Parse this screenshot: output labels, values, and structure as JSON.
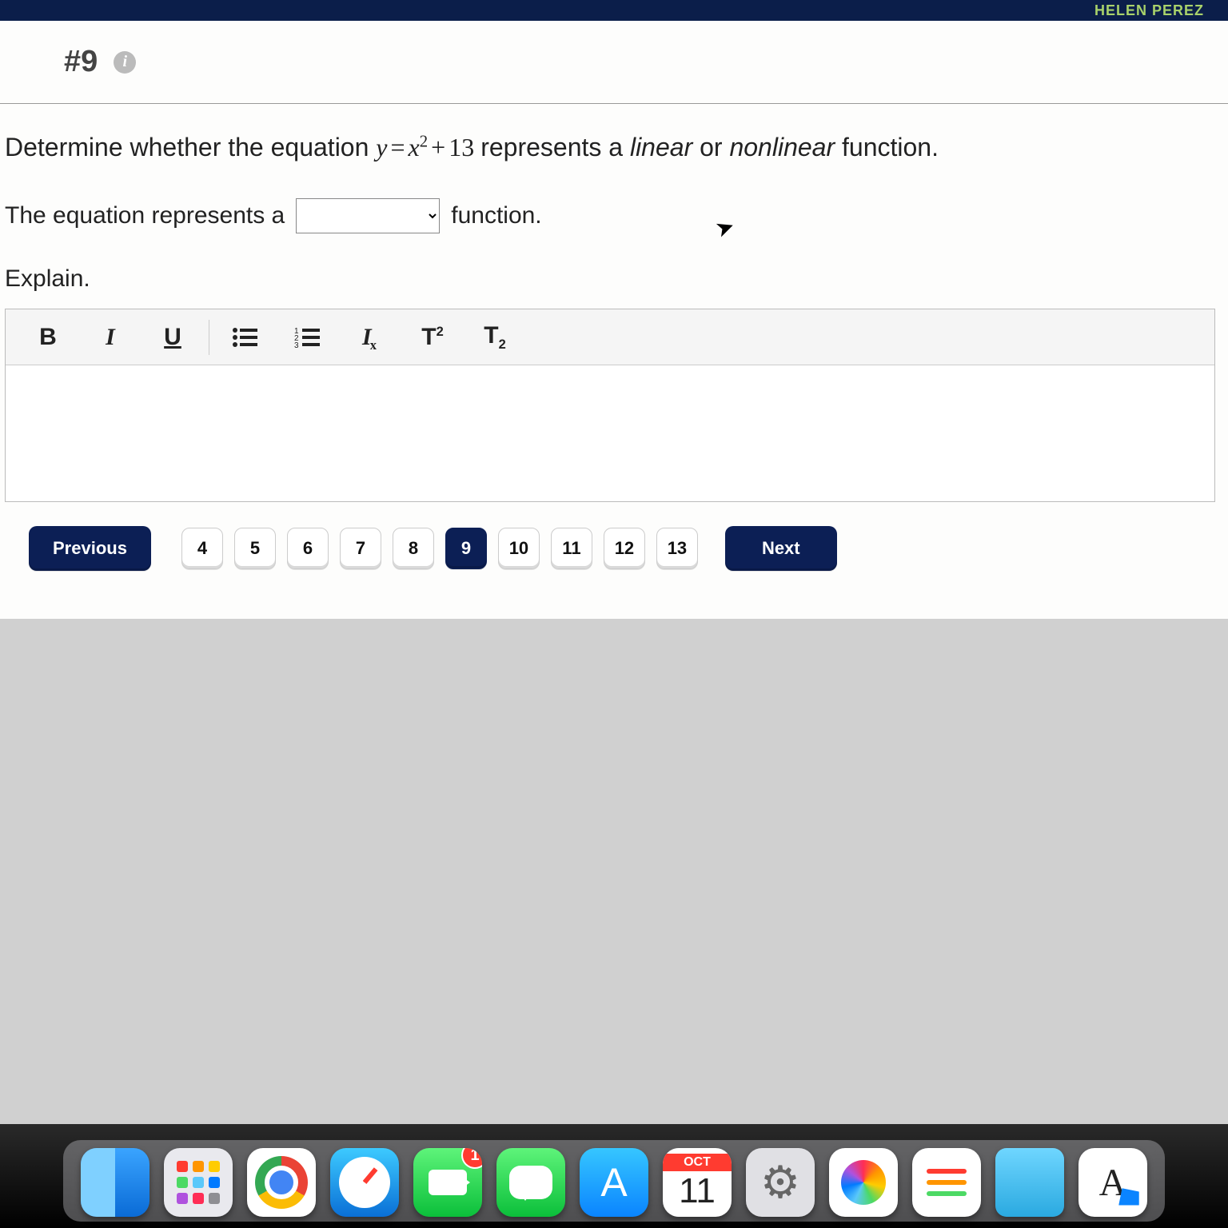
{
  "topbar": {
    "user_name": "HELEN PEREZ"
  },
  "question": {
    "number_label": "#9",
    "prompt_pre": "Determine whether the equation ",
    "equation_lhs": "y",
    "equation_eq": "=",
    "equation_rhs_var": "x",
    "equation_rhs_exp": "2",
    "equation_plus": "+",
    "equation_const": "13",
    "prompt_mid": " represents a ",
    "word_linear": "linear",
    "prompt_or": " or ",
    "word_nonlinear": "nonlinear",
    "prompt_post": " function.",
    "answer_pre": "The equation represents a ",
    "answer_post": " function.",
    "dropdown_value": "",
    "explain_label": "Explain."
  },
  "toolbar": {
    "bold": "B",
    "italic": "I",
    "underline": "U",
    "ul_icon": "≣",
    "ol_icon": "≡",
    "clearfmt_base": "I",
    "clearfmt_x": "x",
    "sup_base": "T",
    "sup_exp": "2",
    "sub_base": "T",
    "sub_exp": "2"
  },
  "nav": {
    "previous": "Previous",
    "next": "Next",
    "pages": [
      "4",
      "5",
      "6",
      "7",
      "8",
      "9",
      "10",
      "11",
      "12",
      "13"
    ],
    "active": "9"
  },
  "dock": {
    "facetime_badge": "1",
    "calendar_month": "OCT",
    "calendar_day": "11",
    "appstore_letter": "A",
    "font_letter": "A"
  }
}
